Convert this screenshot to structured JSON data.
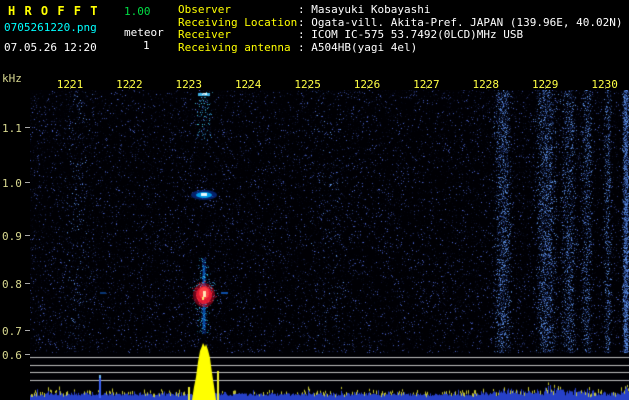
{
  "colors": {
    "title_yellow": "#ffff00",
    "version_green": "#00dd44",
    "filename_cyan": "#00ffff",
    "value_white": "#ffffff",
    "time_tick_yellow": "#ffff44",
    "freq_label": "#d8d890",
    "noise_blue": "#2d4beb",
    "echo_red": "#eb1932",
    "spike_yellow": "#ffff00",
    "reference_line_gray": "#e1e1e1"
  },
  "header": {
    "app_name": "H R O F F T",
    "version": "1.00",
    "filename": "0705261220.png",
    "mode_label": "meteor",
    "mode_value": "1",
    "datetime": "07.05.26 12:20",
    "info": [
      {
        "label": "Observer",
        "value": ": Masayuki Kobayashi"
      },
      {
        "label": "Receiving Location",
        "value": ": Ogata-vill. Akita-Pref. JAPAN (139.96E, 40.02N)"
      },
      {
        "label": "Receiver",
        "value": ": ICOM IC-575 53.7492(0LCD)MHz USB"
      },
      {
        "label": "Receiving antenna",
        "value": ": A504HB(yagi 4el)"
      }
    ]
  },
  "axes": {
    "y_label": "kHz",
    "y_ticks": [
      "1.1",
      "1.0",
      "0.9",
      "0.8",
      "0.7",
      "0.6"
    ],
    "x_ticks": [
      "1221",
      "1222",
      "1223",
      "1224",
      "1225",
      "1226",
      "1227",
      "1228",
      "1229",
      "1230"
    ]
  },
  "chart_data": {
    "type": "heatmap",
    "title": "",
    "xlabel": "",
    "ylabel": "kHz",
    "x_tick_labels": [
      "1221",
      "1222",
      "1223",
      "1224",
      "1225",
      "1226",
      "1227",
      "1228",
      "1229",
      "1230"
    ],
    "y_tick_labels": [
      "1.1",
      "1.0",
      "0.9",
      "0.8",
      "0.7",
      "0.6"
    ],
    "y_range_khz": [
      0.55,
      1.2
    ],
    "legend_position": "none",
    "grid": "off",
    "events": [
      {
        "type": "meteor-echo-head",
        "time_hhmm": "1223",
        "freq_khz": 0.79,
        "intensity": "strong, red core with white center and cyan fringe"
      },
      {
        "type": "echo-trace",
        "time_hhmm": "1223",
        "freq_khz": 1.0,
        "intensity": "moderate cyan blob with white core"
      },
      {
        "type": "echo-trace",
        "time_hhmm": "1223",
        "freq_khz": 1.13,
        "intensity": "weak scattered blue/cyan column"
      }
    ],
    "noise_bands": [
      {
        "time_hhmm": "1228.4",
        "intensity": "strong broadband blue noise"
      },
      {
        "time_hhmm": "1229.0",
        "intensity": "strong broadband blue noise"
      },
      {
        "time_hhmm": "1229.4",
        "intensity": "medium broadband blue noise"
      },
      {
        "time_hhmm": "1230.0",
        "intensity": "strong narrow band at right edge"
      }
    ],
    "signal_panel": {
      "reference_lines": 4,
      "baseline": "blue noise floor with yellow peaks",
      "main_peak_time_hhmm": "1223",
      "main_peak_color": "yellow"
    }
  },
  "spectrogram": {
    "meteor": {
      "x_frac": 0.2905
    },
    "bands": [
      {
        "x": 0.08,
        "w": 0.02,
        "i": 0.12
      },
      {
        "x": 0.5,
        "w": 0.04,
        "i": 0.1
      },
      {
        "x": 0.79,
        "w": 0.013,
        "i": 0.85
      },
      {
        "x": 0.862,
        "w": 0.016,
        "i": 1.0
      },
      {
        "x": 0.9,
        "w": 0.012,
        "i": 0.55
      },
      {
        "x": 0.93,
        "w": 0.008,
        "i": 0.4
      },
      {
        "x": 0.965,
        "w": 0.006,
        "i": 0.3
      },
      {
        "x": 0.995,
        "w": 0.005,
        "i": 1.1
      }
    ]
  }
}
